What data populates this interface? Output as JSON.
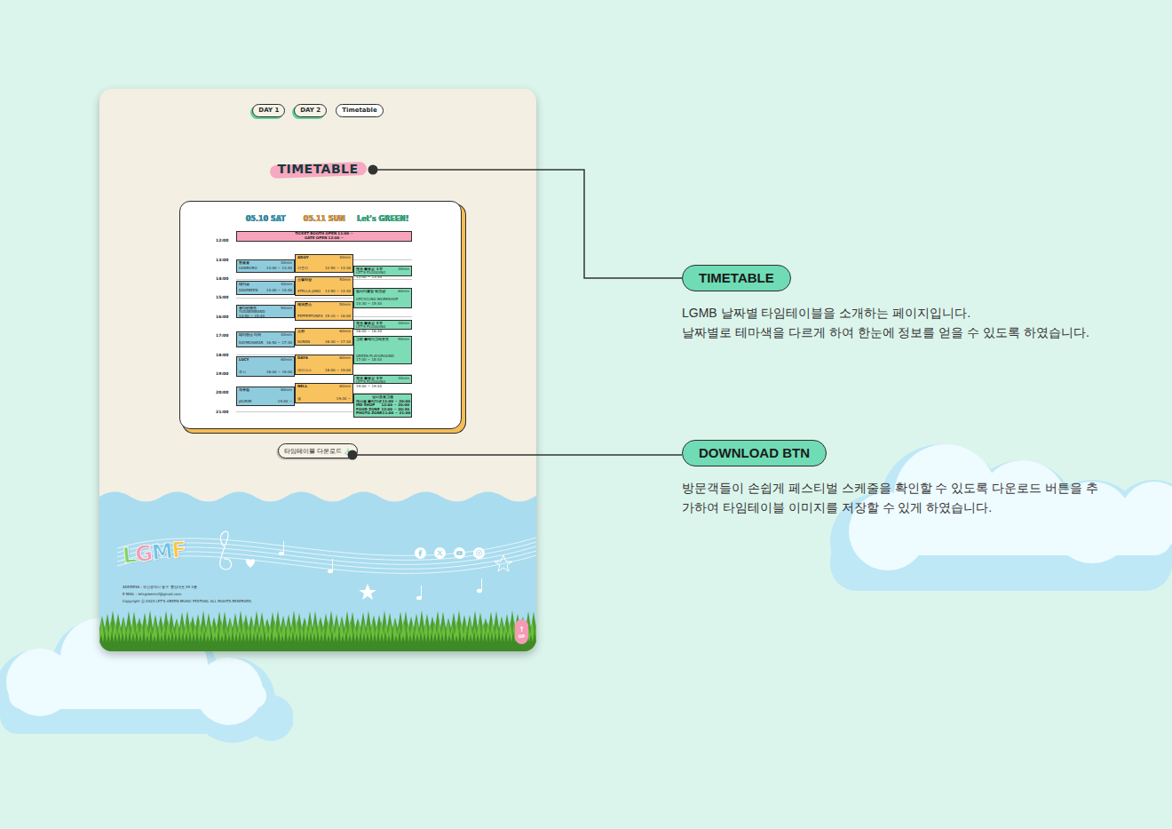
{
  "nav": [
    {
      "label": "DAY 1",
      "selected": false
    },
    {
      "label": "DAY 2",
      "selected": false
    },
    {
      "label": "Timetable",
      "selected": true
    }
  ],
  "title": "TIMETABLE",
  "timetable": {
    "banner": [
      "TICKET BOOTH OPEN 11:00 ~",
      "GATE OPEN 12:00 ~"
    ],
    "times": [
      "12:00",
      "13:00",
      "14:00",
      "15:00",
      "16:00",
      "17:00",
      "18:00",
      "19:00",
      "20:00",
      "21:00"
    ],
    "columns": [
      {
        "label": "05.10 SAT",
        "color": "#8ecbdc",
        "events": [
          {
            "kind": "slot",
            "name": "한로로",
            "sub": "HANRORO",
            "duration": "40min",
            "time": "13:00 ~ 13:40",
            "start": 13.0,
            "end": 13.7
          },
          {
            "kind": "slot",
            "name": "데이브",
            "sub": "DAVEBEEN",
            "duration": "40min",
            "time": "14:00 ~ 14:40",
            "start": 14.1,
            "end": 14.85
          },
          {
            "kind": "slot",
            "name": "유다빈밴드",
            "sub": "YUDABINBAND",
            "duration": "50min",
            "time": "14:50 ~ 15:40",
            "start": 15.36,
            "end": 16.1
          },
          {
            "kind": "slot",
            "name": "데이먼스 이어",
            "sub": "DAYMOSSEAR",
            "duration": "40min",
            "time": "16:50 ~ 17:30",
            "start": 16.8,
            "end": 17.6
          },
          {
            "kind": "slot",
            "name": "LUCY",
            "sub": "루시",
            "duration": "60min",
            "time": "18:00 ~ 19:00",
            "start": 18.1,
            "end": 19.15
          },
          {
            "kind": "slot",
            "name": "자우림",
            "sub": "JAURIM",
            "duration": "80min",
            "time": "19:40 ~",
            "start": 19.66,
            "end": 20.7
          }
        ]
      },
      {
        "label": "05.11 SUN",
        "color": "#f8c25f",
        "events": [
          {
            "kind": "slot",
            "name": "ADOY",
            "sub": "아도이",
            "duration": "40min",
            "time": "12:50 ~ 13:30",
            "start": 12.7,
            "end": 13.7
          },
          {
            "kind": "slot",
            "name": "스텔라장",
            "sub": "STELLA JANG",
            "duration": "50min",
            "time": "13:50 ~ 14:40",
            "start": 13.9,
            "end": 14.9
          },
          {
            "kind": "slot",
            "name": "페퍼톤스",
            "sub": "PEPPERTONES",
            "duration": "50min",
            "time": "15:10 ~ 16:00",
            "start": 15.2,
            "end": 16.2
          },
          {
            "kind": "slot",
            "name": "소란",
            "sub": "SORAN",
            "duration": "60min",
            "time": "16:30 ~ 17:30",
            "start": 16.6,
            "end": 17.55
          },
          {
            "kind": "slot",
            "name": "DAY6",
            "sub": "데이식스",
            "duration": "60min",
            "time": "18:00 ~ 19:00",
            "start": 18.0,
            "end": 19.05
          },
          {
            "kind": "slot",
            "name": "NELL",
            "sub": "넬",
            "duration": "60min",
            "time": "19:30 ~",
            "start": 19.5,
            "end": 20.55
          }
        ]
      },
      {
        "label": "Let's GREEN!",
        "color": "#7ddcb6",
        "events": [
          {
            "kind": "slot",
            "name": "렛츠 플로깅 1부",
            "sub": "LET'S PLOGGING",
            "duration": "30min",
            "time": "13:00 ~ 13:30",
            "start": 13.3,
            "end": 13.9
          },
          {
            "kind": "slot",
            "name": "업사이클링 워크샵",
            "sub": "UPCYCLING WORKSHOP",
            "duration": "60min",
            "time": "14:30 ~ 15:30",
            "start": 14.5,
            "end": 15.55
          },
          {
            "kind": "slot",
            "name": "렛츠 플로깅 2부",
            "sub": "LET'S PLOGGING",
            "duration": "30min",
            "time": "16:00 ~ 16:30",
            "start": 16.15,
            "end": 16.7
          },
          {
            "kind": "slot",
            "name": "그린 플레이그라운드",
            "sub": "GREEN PLAYGROUND",
            "duration": "90min",
            "time": "17:00 ~ 18:30",
            "start": 17.0,
            "end": 18.5
          },
          {
            "kind": "slot",
            "name": "렛츠 플로깅 3부",
            "sub": "LET'S PLOGGING",
            "duration": "30min",
            "time": "19:00 ~ 19:30",
            "start": 19.05,
            "end": 19.55
          },
          {
            "kind": "list",
            "name": "상시프로그램",
            "start": 20.05,
            "end": 21.3,
            "items": [
              {
                "label": "재사용 플리마켓",
                "time": "11:00 ~ 20:00"
              },
              {
                "label": "MD SHOP",
                "time": "12:00 ~ 20:00"
              },
              {
                "label": "FOOD ZONE",
                "time": "12:00 ~ 20:30"
              },
              {
                "label": "PHOTO ZONE",
                "time": "11:00 ~ 21:00"
              }
            ]
          }
        ]
      }
    ]
  },
  "download": {
    "label": "타임테이블 다운로드"
  },
  "footer": {
    "logo": "LGMF",
    "lines": [
      "ADDRESS : 부산광역시 동구 중앙대로 29 3층",
      "E-MAIL : letsgreenmf@gmail.com",
      "Copyright ⓒ 2024 LET'S GREEN MUSIC FESTIVAL ALL RIGHTS RESERVED."
    ],
    "up": {
      "arrow": "↑",
      "label": "UP"
    }
  },
  "annotations": [
    {
      "label": "TIMETABLE",
      "lines": [
        "LGMB 날짜별 타임테이블을 소개하는 페이지입니다.",
        "날짜별로 테마색을 다르게 하여 한눈에 정보를 얻을 수 있도록 하였습니다."
      ]
    },
    {
      "label": "DOWNLOAD BTN",
      "lines": [
        "방문객들이 손쉽게 페스티벌 스케줄을 확인할 수 있도록 다운로드 버튼을 추",
        "가하여 타임테이블 이미지를 저장할 수 있게 하였습니다."
      ]
    }
  ]
}
